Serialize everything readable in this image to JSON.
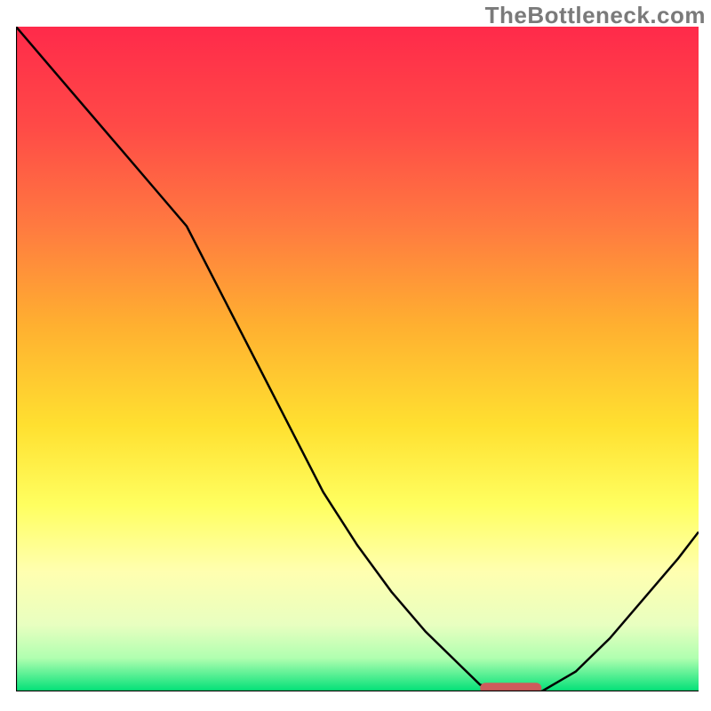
{
  "watermark": "TheBottleneck.com",
  "chart_data": {
    "type": "line",
    "title": "",
    "xlabel": "",
    "ylabel": "",
    "xlim": [
      0,
      100
    ],
    "ylim": [
      0,
      100
    ],
    "grid": false,
    "legend": "none",
    "background_gradient": {
      "stops": [
        {
          "pos": 0.0,
          "color": "#ff2a4a"
        },
        {
          "pos": 0.15,
          "color": "#ff4a47"
        },
        {
          "pos": 0.3,
          "color": "#ff7a40"
        },
        {
          "pos": 0.45,
          "color": "#ffb030"
        },
        {
          "pos": 0.6,
          "color": "#ffe030"
        },
        {
          "pos": 0.72,
          "color": "#ffff60"
        },
        {
          "pos": 0.82,
          "color": "#ffffb0"
        },
        {
          "pos": 0.9,
          "color": "#e8ffc0"
        },
        {
          "pos": 0.95,
          "color": "#b0ffb0"
        },
        {
          "pos": 1.0,
          "color": "#00e077"
        }
      ]
    },
    "series": [
      {
        "name": "bottleneck-curve",
        "color": "#000000",
        "x": [
          0,
          5,
          10,
          15,
          20,
          25,
          30,
          35,
          40,
          45,
          50,
          55,
          60,
          65,
          68,
          72,
          77,
          82,
          87,
          92,
          97,
          100
        ],
        "y": [
          100,
          94,
          88,
          82,
          76,
          70,
          60,
          50,
          40,
          30,
          22,
          15,
          9,
          4,
          1,
          0,
          0,
          3,
          8,
          14,
          20,
          24
        ]
      }
    ],
    "marker": {
      "name": "optimal-range",
      "shape": "rounded-bar",
      "color": "#cd5c5c",
      "x_range": [
        68,
        77
      ],
      "y": 0.5,
      "height": 1.6
    },
    "frame": {
      "sides": [
        "left",
        "bottom"
      ],
      "color": "#000000",
      "width": 2
    }
  }
}
